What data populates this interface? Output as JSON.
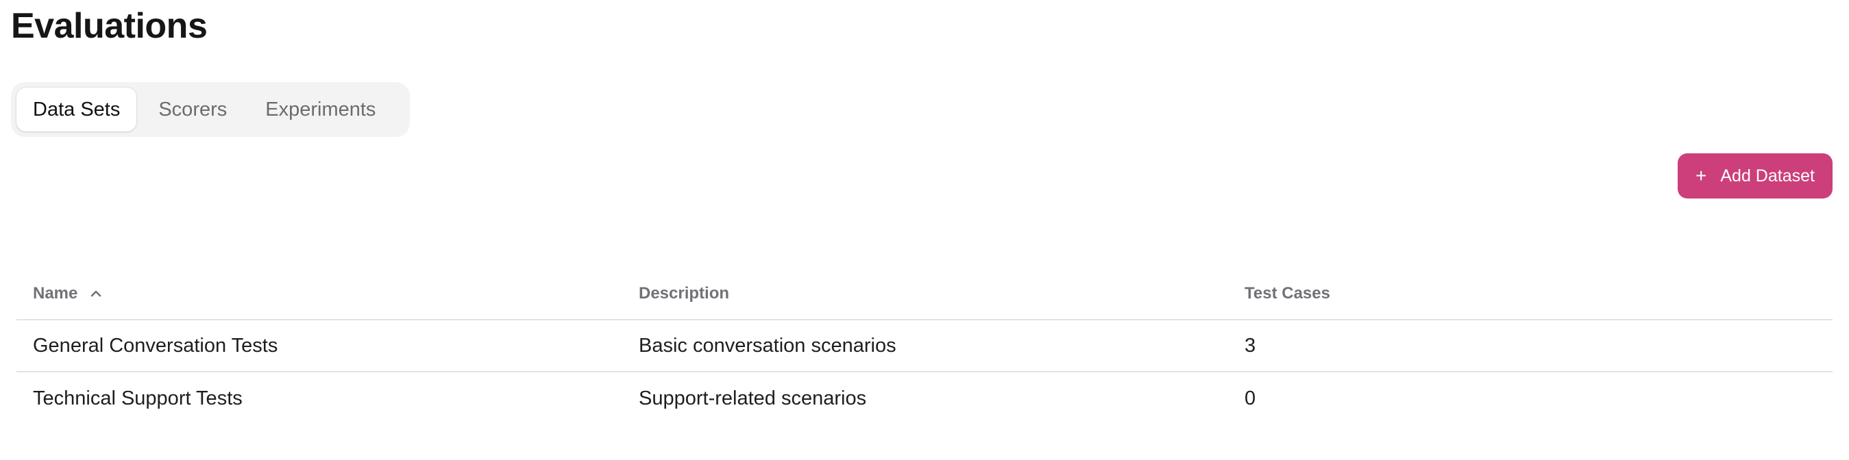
{
  "page": {
    "title": "Evaluations"
  },
  "tabs": [
    {
      "label": "Data Sets",
      "active": true
    },
    {
      "label": "Scorers",
      "active": false
    },
    {
      "label": "Experiments",
      "active": false
    }
  ],
  "toolbar": {
    "add_label": "Add Dataset",
    "add_icon": "plus-icon",
    "accent_color": "#cc3f7a"
  },
  "table": {
    "columns": [
      {
        "label": "Name",
        "sort": "ascending",
        "sort_icon": "chevron-up-icon"
      },
      {
        "label": "Description"
      },
      {
        "label": "Test Cases"
      }
    ],
    "rows": [
      {
        "name": "General Conversation Tests",
        "description": "Basic conversation scenarios",
        "test_cases": "3"
      },
      {
        "name": "Technical Support Tests",
        "description": "Support-related scenarios",
        "test_cases": "0"
      }
    ]
  }
}
